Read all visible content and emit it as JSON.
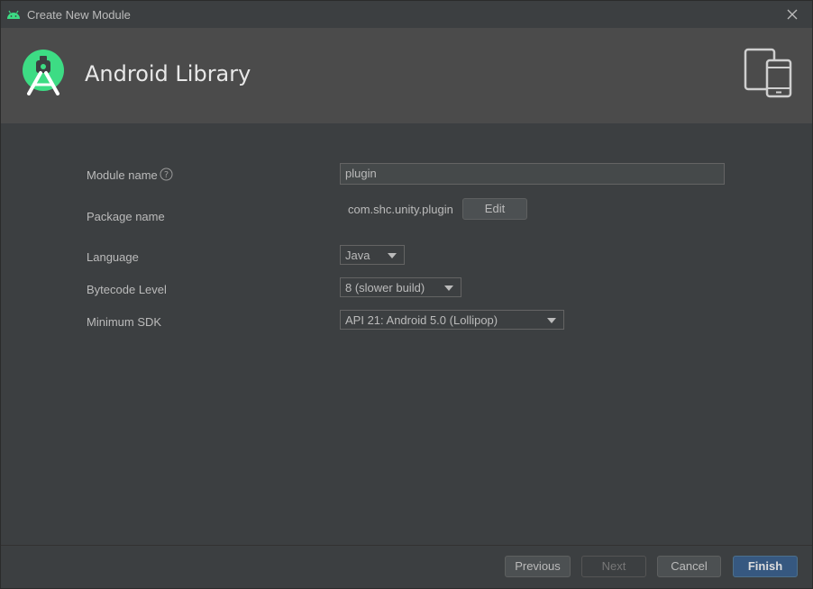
{
  "window": {
    "title": "Create New Module"
  },
  "header": {
    "title": "Android Library"
  },
  "form": {
    "module_name": {
      "label": "Module name",
      "value": "plugin"
    },
    "package_name": {
      "label": "Package name",
      "value": "com.shc.unity.plugin",
      "edit_label": "Edit"
    },
    "language": {
      "label": "Language",
      "selected": "Java"
    },
    "bytecode_level": {
      "label": "Bytecode Level",
      "selected": "8 (slower build)"
    },
    "minimum_sdk": {
      "label": "Minimum SDK",
      "selected": "API 21: Android 5.0 (Lollipop)"
    }
  },
  "footer": {
    "previous_label": "Previous",
    "next_label": "Next",
    "cancel_label": "Cancel",
    "finish_label": "Finish"
  },
  "colors": {
    "android_green": "#3ddc84",
    "primary_button": "#365880",
    "header_bg": "#4b4b4b",
    "body_bg": "#3c3f41"
  }
}
